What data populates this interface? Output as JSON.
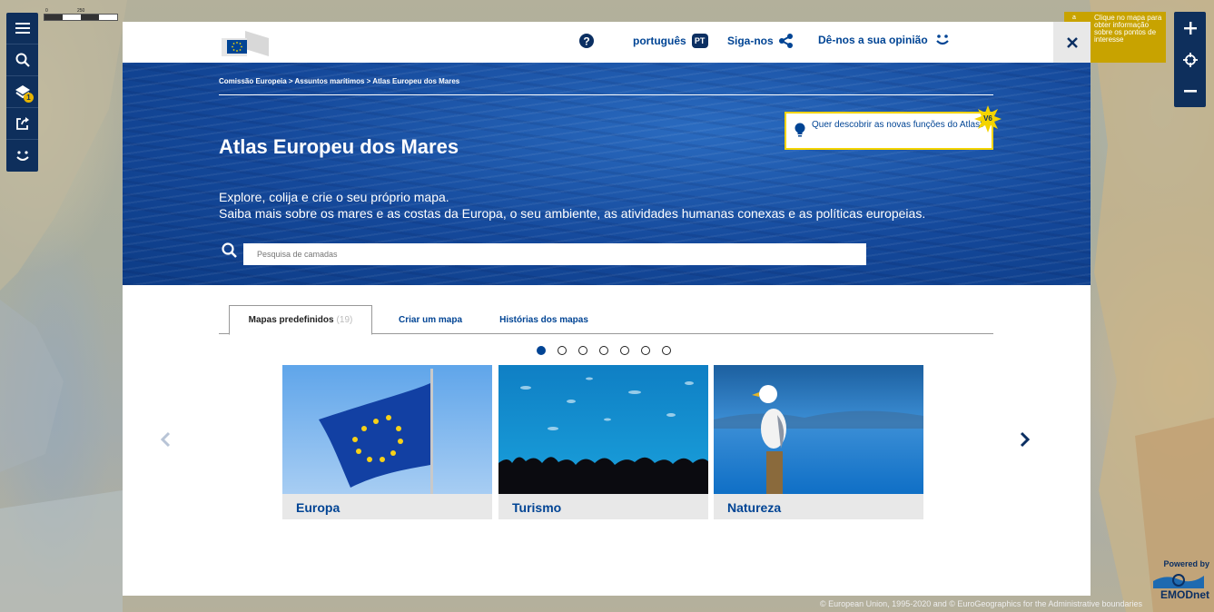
{
  "map": {
    "copyright": "© European Union, 1995-2020 and © EuroGeographics for the Administrative boundaries",
    "powered_by": "Powered by",
    "powered_logo": "EMODnet",
    "scale_labels": [
      "0",
      "250"
    ],
    "tooltip_letter": "a",
    "tooltip": "Clique no mapa para obter informação sobre os pontos de interesse",
    "layers_badge": "1",
    "left_toolbar_icons": [
      "menu-icon",
      "search-icon",
      "layers-icon",
      "share-icon",
      "feedback-icon"
    ],
    "right_toolbar_icons": [
      "zoom-in-icon",
      "locate-icon",
      "zoom-out-icon"
    ]
  },
  "header": {
    "language": "português",
    "language_code": "PT",
    "follow": "Siga-nos",
    "feedback": "Dê-nos a sua opinião"
  },
  "hero": {
    "breadcrumb": "Comissão Europeia > Assuntos marítimos > Atlas Europeu dos Mares",
    "title": "Atlas Europeu dos Mares",
    "lead_line1": "Explore, colija e crie o seu próprio mapa.",
    "lead_line2": "Saiba mais sobre os mares e as costas da Europa, o seu ambiente, as atividades humanas conexas e as políticas europeias.",
    "search_placeholder": "Pesquisa de camadas",
    "new_features": "Quer descobrir as novas funções do Atlas?",
    "version_badge": "V6"
  },
  "tabs": [
    {
      "label": "Mapas predefinidos",
      "count": "(19)"
    },
    {
      "label": "Criar um mapa"
    },
    {
      "label": "Histórias dos mapas"
    }
  ],
  "carousel": {
    "page_count": 7,
    "active_page": 1,
    "prev": "‹",
    "next": "›",
    "cards": [
      {
        "title": "Europa"
      },
      {
        "title": "Turismo"
      },
      {
        "title": "Natureza"
      }
    ]
  },
  "colors": {
    "eu_blue": "#004494",
    "eu_yellow": "#f4d400",
    "toolbar_navy": "#0e2f5c"
  }
}
